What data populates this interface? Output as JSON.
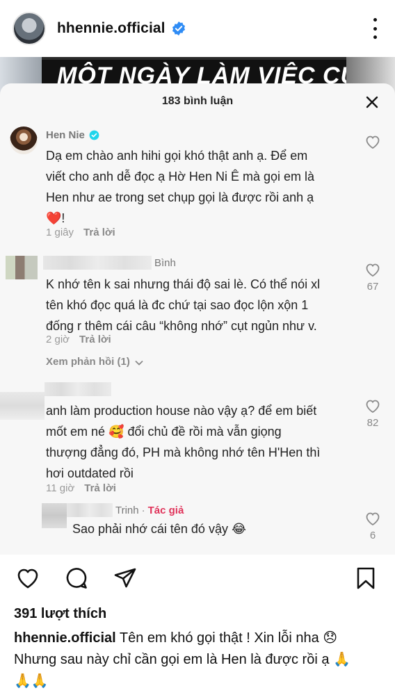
{
  "post": {
    "username": "hhennie.official"
  },
  "video_title": "MỘT NGÀY LÀM VIỆC CỦA",
  "sheet": {
    "title": "183 bình luận"
  },
  "comments": [
    {
      "name": "Hen Nie",
      "lines": [
        "Dạ em chào anh hihi gọi khó thật anh ạ. Để em",
        "viết cho anh dễ đọc ạ Hờ Hen Ni Ê mà gọi em là",
        "Hen như ae trong set chụp gọi là được rồi anh ạ",
        "!"
      ],
      "emoji": "❤️",
      "time": "1 giây",
      "reply": "Trả lời",
      "likes": ""
    },
    {
      "name": "Bình",
      "lines": [
        "K nhớ tên k sai nhưng thái độ sai lè. Có thể nói xl",
        "tên khó đọc quá là đc chứ tại sao đọc lộn xộn 1",
        "đống r thêm cái câu “không nhớ” cụt ngủn như v."
      ],
      "time": "2 giờ",
      "reply": "Trả lời",
      "likes": "67",
      "view_replies": "Xem phản hồi (1)"
    },
    {
      "name": "",
      "lines": [
        "anh làm production house nào vậy ạ? để em biết",
        "mốt em né",
        "đổi chủ đề rồi mà vẫn giọng",
        "thượng đẳng đó, PH mà không nhớ tên H'Hen thì",
        "hơi outdated rồi"
      ],
      "emoji": "🥰",
      "time": "11 giờ",
      "reply": "Trả lời",
      "likes": "82"
    },
    {
      "name": "Trinh",
      "author_tag": "Tác giả",
      "separator": "·",
      "lines": [
        "Sao phải nhớ cái tên đó vậy"
      ],
      "emoji": "😂",
      "likes": "6"
    }
  ],
  "likes_text": "391 lượt thích",
  "caption": {
    "username": "hhennie.official",
    "text_line1": " Tên em khó gọi thật ! Xin lỗi nha ",
    "emoji1": "😞",
    "text_line2": "Nhưng sau này chỉ cần gọi em là Hen là được rồi ạ ",
    "emoji_pray": "🙏",
    "emoji_pray2": "🙏🙏"
  },
  "colors": {
    "verified": "#2f8cf5",
    "author_tag": "#e0335a",
    "heart": "#e02424"
  }
}
